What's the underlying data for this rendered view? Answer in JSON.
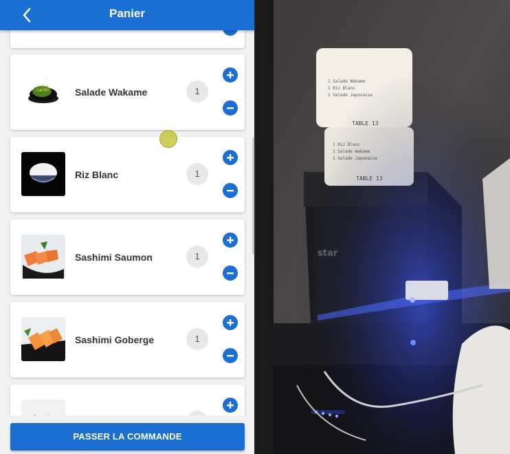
{
  "app_bar": {
    "title": "Panier",
    "back_icon": "arrow-back-icon",
    "color": "#1b6fd2"
  },
  "cart": {
    "items": [
      {
        "name": "",
        "quantity": "",
        "thumb": "partial-item"
      },
      {
        "name": "Salade Wakame",
        "quantity": "1",
        "thumb": "wakame-salad"
      },
      {
        "name": "Riz Blanc",
        "quantity": "1",
        "thumb": "white-rice"
      },
      {
        "name": "Sashimi Saumon",
        "quantity": "1",
        "thumb": "salmon-sashimi"
      },
      {
        "name": "Sashimi Goberge",
        "quantity": "1",
        "thumb": "goberge-sashimi"
      },
      {
        "name": "",
        "quantity": "",
        "thumb": "partial-item"
      }
    ],
    "add_icon": "add-circle-icon",
    "remove_icon": "remove-circle-icon"
  },
  "checkout": {
    "label": "PASSER LA COMMANDE"
  },
  "printer_photo": {
    "brand_text": "star",
    "ticket_text": "TABLE 13",
    "ticket_lines": [
      "1  Salade Wakame",
      "1  Riz Blanc",
      "1  Salade Japonaise"
    ]
  }
}
